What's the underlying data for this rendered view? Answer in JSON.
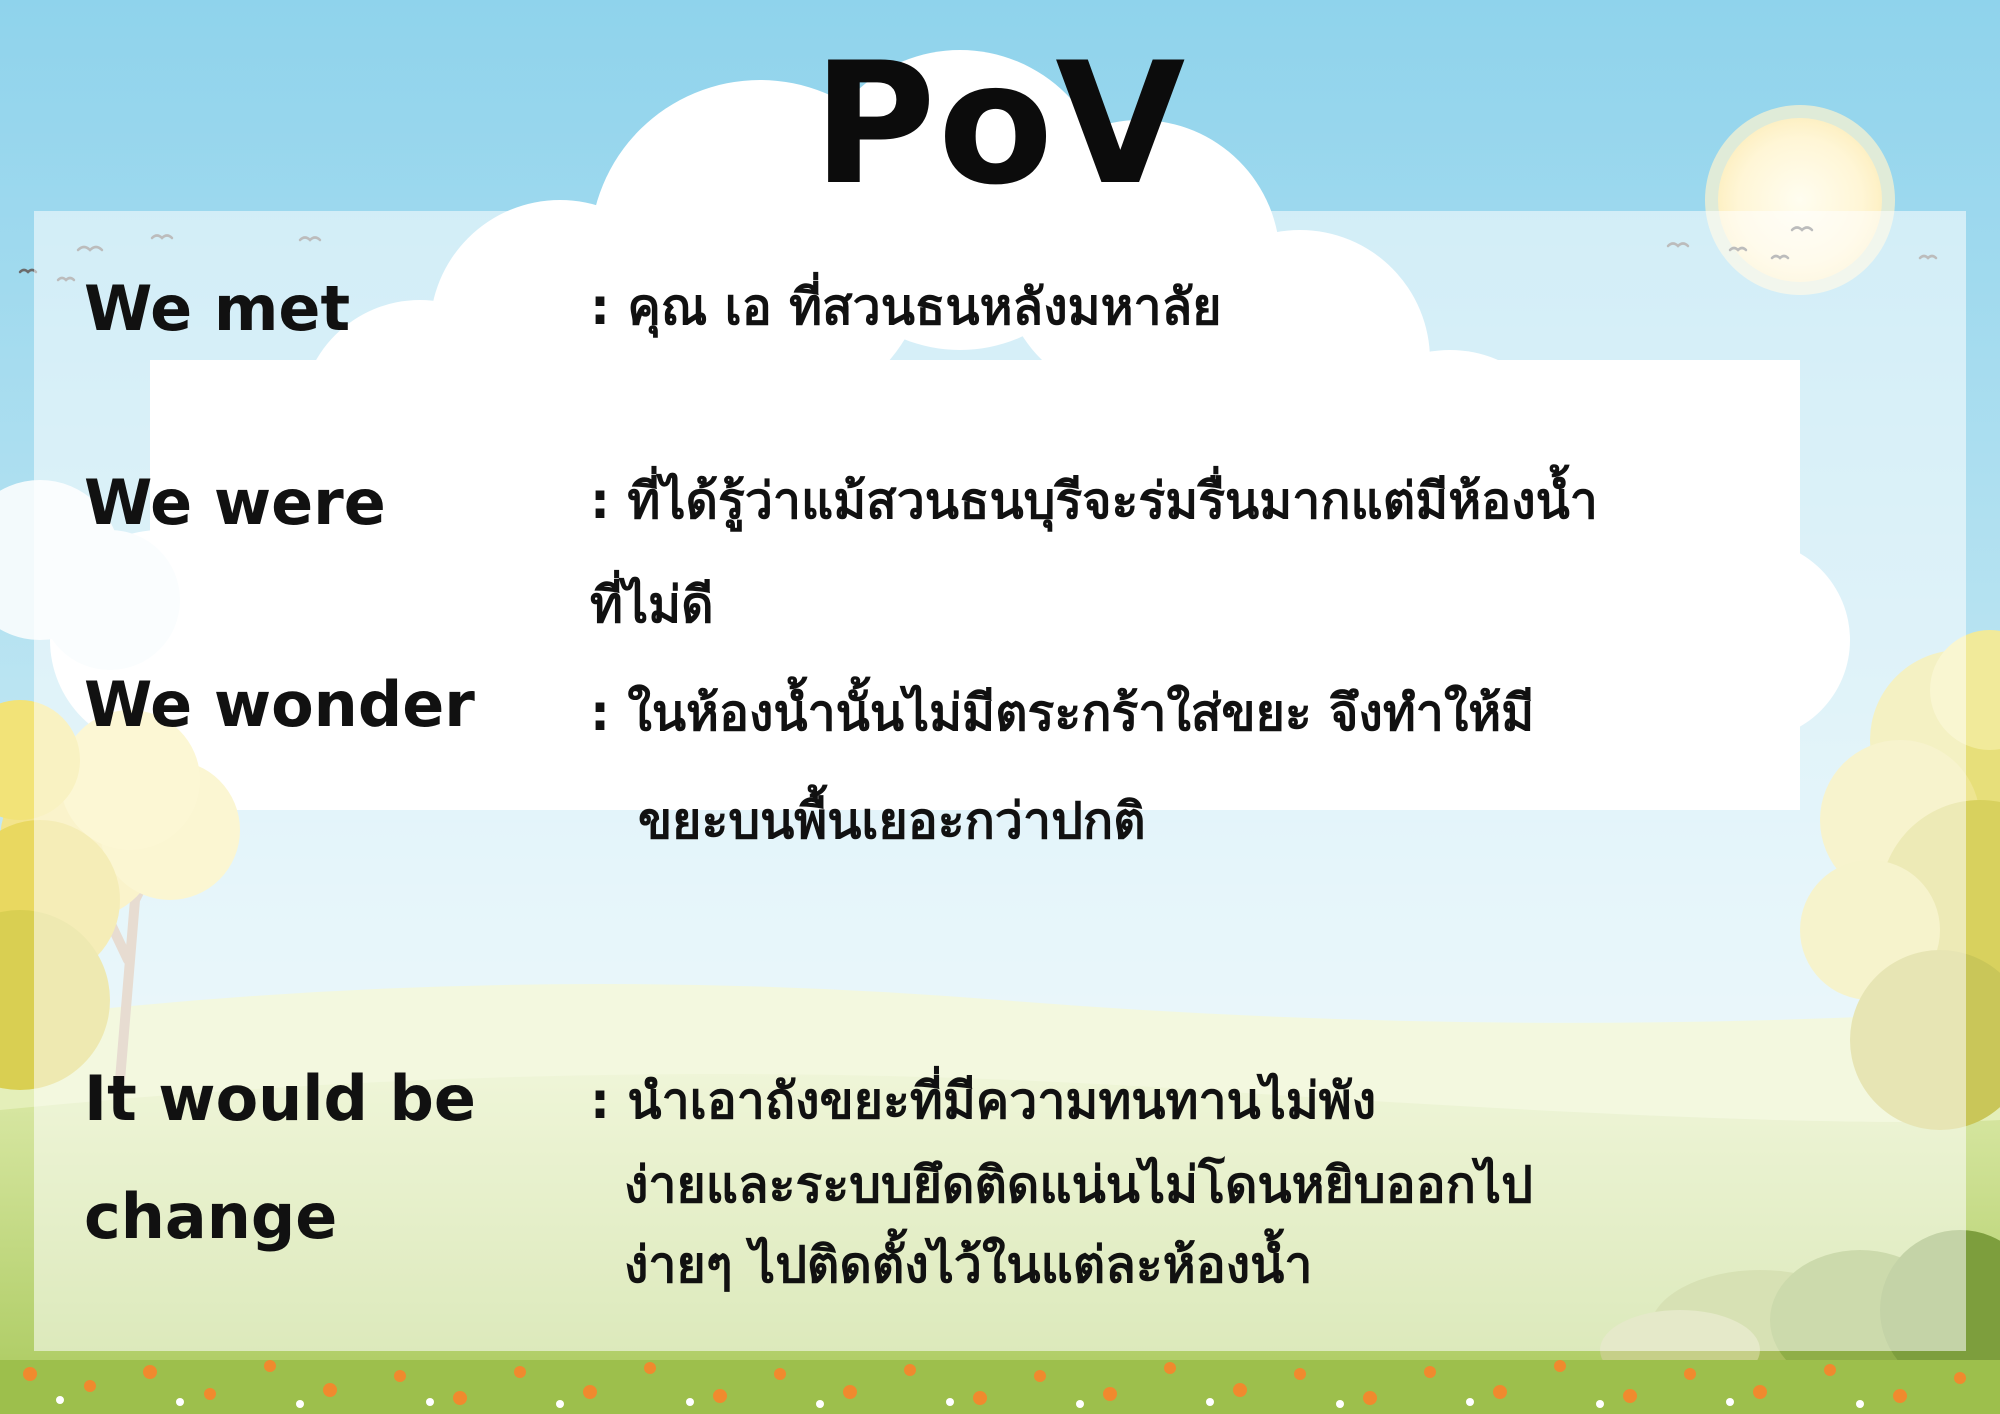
{
  "title": "PoV",
  "rows": [
    {
      "label": "We met",
      "lines": [
        ": คุณ เอ ที่สวนธนหลังมหาลัย"
      ]
    },
    {
      "label": "We were",
      "lines": [
        ": ที่ได้รู้ว่าแม้สวนธนบุรีจะร่มรื่นมากแต่มีห้องน้ำ",
        "ที่ไม่ดี"
      ]
    },
    {
      "label": "We wonder",
      "lines": [
        ": ในห้องน้ำนั้นไม่มีตระกร้าใส่ขยะ จึงทำให้มี",
        "ขยะบนพื้นเยอะกว่าปกติ"
      ]
    },
    {
      "label_lines": [
        "It would be",
        "change"
      ],
      "lines": [
        ": นำเอาถังขยะที่มีความทนทานไม่พัง",
        "ง่ายและระบบยึดติดแน่นไม่โดนหยิบออกไป",
        "ง่ายๆ ไปติดตั้งไว้ในแต่ละห้องน้ำ"
      ]
    }
  ],
  "colors": {
    "sky_top": "#8fd3ec",
    "sky_bottom": "#d6eef5",
    "grass": "#b6d46a",
    "text": "#111111",
    "flowers": "#f08a2e"
  }
}
